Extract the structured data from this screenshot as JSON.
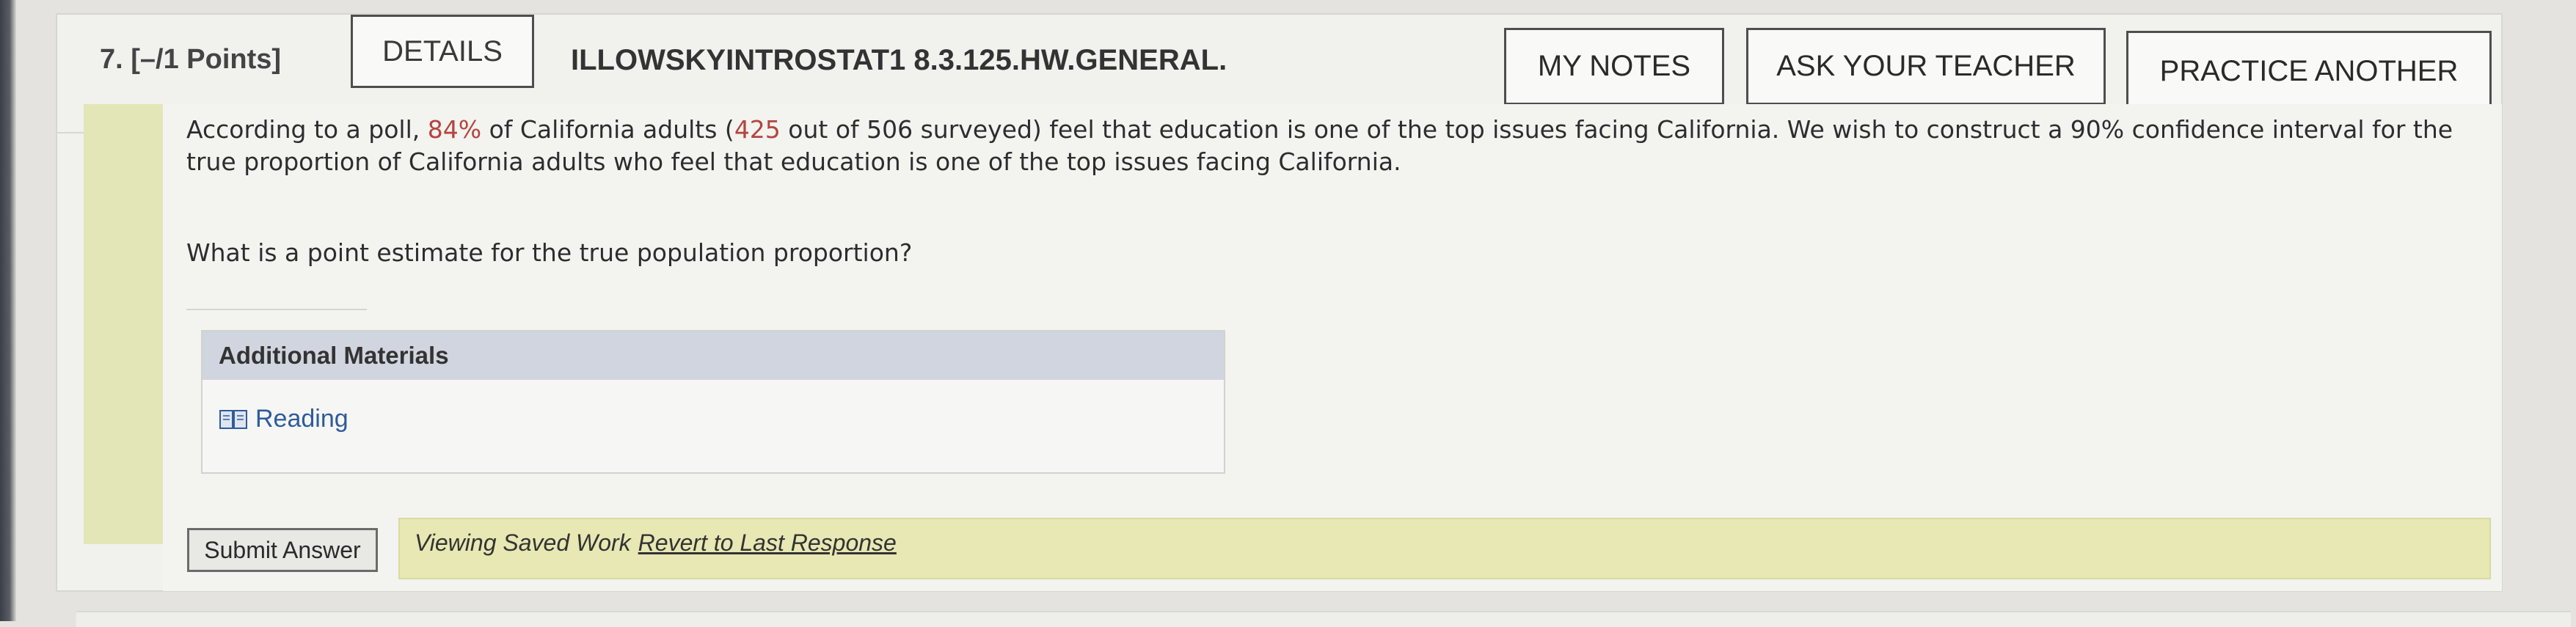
{
  "question": {
    "number_label": "7. [–/1 Points]",
    "details_label": "DETAILS",
    "code": "ILLOWSKYINTROSTAT1 8.3.125.HW.GENERAL."
  },
  "toolbar": {
    "my_notes": "MY NOTES",
    "ask_teacher": "ASK YOUR TEACHER",
    "practice_another": "PRACTICE ANOTHER"
  },
  "problem": {
    "part1": "According to a poll, ",
    "percent": "84%",
    "part2": " of California adults (",
    "count": "425",
    "part3": " out of 506 surveyed) feel that education is one of the top issues facing California. We wish to construct a 90% confidence interval for the true proportion of California adults who feel that education is one of the top issues facing California."
  },
  "prompt": "What is a point estimate for the true population proportion?",
  "answer": {
    "value": ""
  },
  "materials": {
    "title": "Additional Materials",
    "reading_label": "Reading"
  },
  "footer": {
    "submit_label": "Submit Answer",
    "viewing_text": "Viewing Saved Work",
    "revert_label": "Revert to Last Response"
  },
  "colors": {
    "highlight_red": "#b4453e",
    "link_blue": "#2e5c9c",
    "saved_bar": "#e7e8b3",
    "materials_header": "#d1d5df"
  }
}
